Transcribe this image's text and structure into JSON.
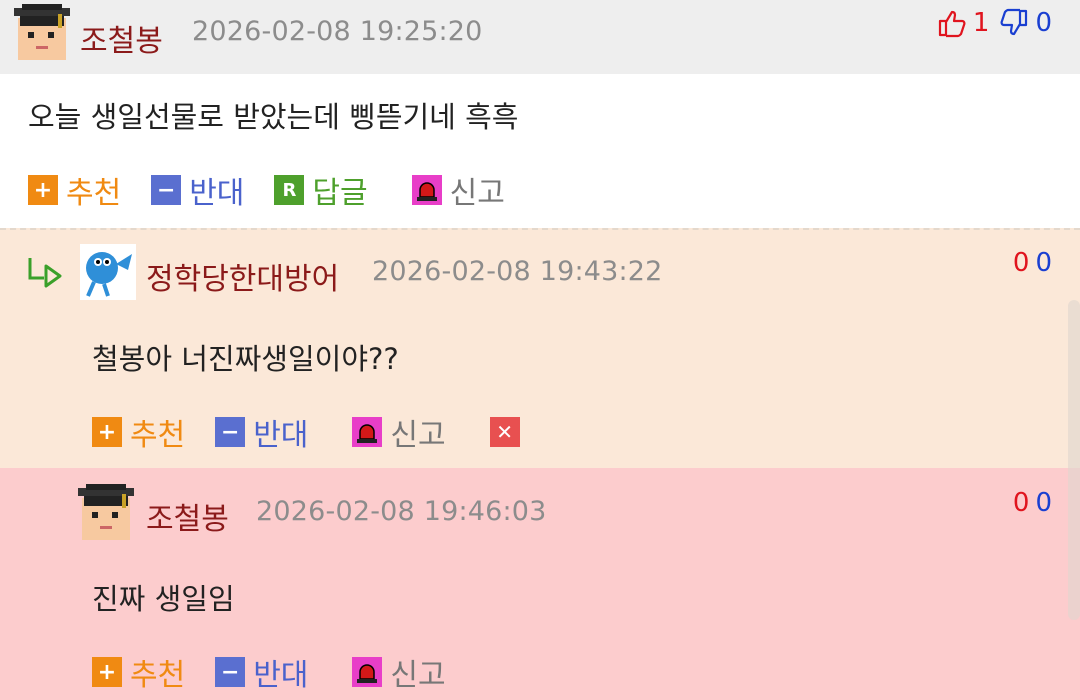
{
  "comments": [
    {
      "nickname": "조철봉",
      "timestamp": "2026-02-08 19:25:20",
      "up_count": "1",
      "down_count": "0",
      "text": "오늘 생일선물로 받았는데 삥뜯기네 흑흑",
      "avatar_icon": "graduate-avatar-icon",
      "actions": {
        "recommend": "추천",
        "oppose": "반대",
        "reply": "답글",
        "report": "신고"
      }
    },
    {
      "nickname": "정학당한대방어",
      "timestamp": "2026-02-08 19:43:22",
      "up_count": "0",
      "down_count": "0",
      "text": "철봉아 너진짜생일이야??",
      "avatar_icon": "blue-fish-avatar-icon",
      "actions": {
        "recommend": "추천",
        "oppose": "반대",
        "report": "신고"
      }
    },
    {
      "nickname": "조철봉",
      "timestamp": "2026-02-08 19:46:03",
      "up_count": "0",
      "down_count": "0",
      "text": "진짜 생일임",
      "avatar_icon": "graduate-avatar-icon",
      "actions": {
        "recommend": "추천",
        "oppose": "반대",
        "report": "신고"
      }
    }
  ],
  "icons": {
    "recommend": "plus-icon",
    "oppose": "minus-icon",
    "reply": "reply-r-icon",
    "report": "siren-icon",
    "delete": "close-icon",
    "thumb_up": "thumb-up-icon",
    "thumb_down": "thumb-down-icon",
    "reply_indent": "reply-arrow-icon"
  },
  "colors": {
    "nickname": "#8b1a1a",
    "up": "#e0141e",
    "down": "#1a3fd1",
    "recommend": "#f08a12",
    "oppose": "#4a62cc",
    "reply": "#4ea02c",
    "reply_bg": "#fbe8d8",
    "own_bg": "#fccccd"
  }
}
